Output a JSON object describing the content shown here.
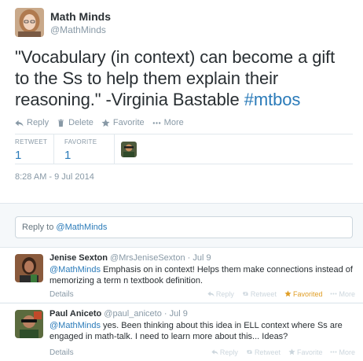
{
  "tweet": {
    "author_name": "Math Minds",
    "author_handle": "@MathMinds",
    "text_before_tag": "\"Vocabulary (in context) can become a gift to the Ss to help them explain their reasoning.\" -Virginia Bastable ",
    "hashtag": "#mtbos",
    "actions": {
      "reply": "Reply",
      "delete": "Delete",
      "favorite": "Favorite",
      "more": "More"
    },
    "stats": {
      "retweet_label": "RETWEET",
      "retweet_count": "1",
      "favorite_label": "FAVORITE",
      "favorite_count": "1"
    },
    "timestamp": "8:28 AM - 9 Jul 2014"
  },
  "reply_box": {
    "prefix": "Reply to ",
    "mention": "@MathMinds"
  },
  "replies": [
    {
      "name": "Jenise Sexton",
      "meta": " @MrsJeniseSexton · Jul 9",
      "mention": "@MathMinds",
      "text": " Emphasis on in context! Helps them make connections instead of memorizing a term n textbook definition.",
      "details": "Details",
      "reply": "Reply",
      "retweet": "Retweet",
      "favorite": "Favorited",
      "more": "More"
    },
    {
      "name": "Paul Aniceto",
      "meta": " @paul_aniceto · Jul 9",
      "mention": "@MathMinds",
      "text": " yes. Been thinking about this idea in ELL context where Ss are engaged in math-talk. I need to learn more about this... Ideas?",
      "details": "Details",
      "reply": "Reply",
      "retweet": "Retweet",
      "favorite": "Favorite",
      "more": "More"
    }
  ],
  "colors": {
    "link": "#2b7bb9",
    "muted": "#8899a6",
    "favorited": "#e09e26",
    "background": "#f5f8fa"
  }
}
